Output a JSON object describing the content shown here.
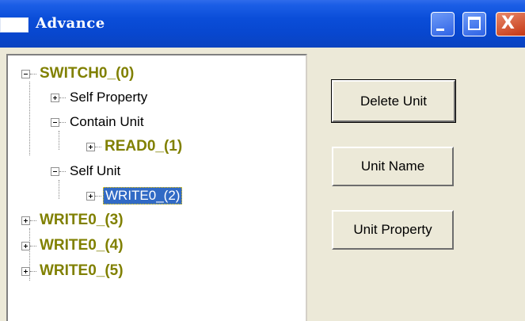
{
  "window": {
    "title": "Advance",
    "controls": {
      "minimize_icon": "minimize-icon",
      "maximize_icon": "maximize-icon",
      "close_icon": "close-icon",
      "close_glyph": "X"
    }
  },
  "tree": {
    "nodes": [
      {
        "label": "SWITCH0_(0)",
        "expanded": true
      },
      {
        "label": "Self Property",
        "expanded": false
      },
      {
        "label": "Contain Unit",
        "expanded": true
      },
      {
        "label": "READ0_(1)",
        "expanded": false
      },
      {
        "label": "Self Unit",
        "expanded": true
      },
      {
        "label": "WRITE0_(2)",
        "expanded": false,
        "selected": true
      },
      {
        "label": "WRITE0_(3)",
        "expanded": false
      },
      {
        "label": "WRITE0_(4)",
        "expanded": false
      },
      {
        "label": "WRITE0_(5)",
        "expanded": false
      }
    ]
  },
  "buttons": {
    "delete_unit": "Delete Unit",
    "unit_name": "Unit Name",
    "unit_property": "Unit Property"
  },
  "colors": {
    "titlebar": "#0A4DD8",
    "big_node_label": "#808000",
    "selection": "#316AC5",
    "face": "#ECE9D8"
  }
}
